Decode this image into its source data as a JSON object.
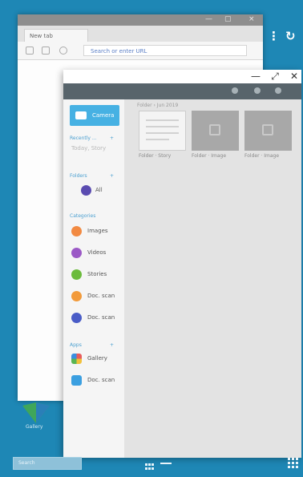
{
  "browser": {
    "tab_label": "New tab",
    "url": "Search or enter URL",
    "controls": {
      "minimize": "—",
      "maximize": "▢",
      "close": "×"
    }
  },
  "top_controls": {
    "more": "⋮",
    "refresh": "↻"
  },
  "gallery": {
    "window_controls": {
      "minimize": "—",
      "maximize": "⤢",
      "close": "✕"
    },
    "camera_label": "Camera",
    "sections": [
      {
        "label": "Recently ...",
        "expand": "+"
      },
      {
        "label": "Folders",
        "expand": "+"
      },
      {
        "label": "Categories",
        "expand": ""
      },
      {
        "label": "Apps",
        "expand": "+"
      }
    ],
    "recent_item": "Today, Story",
    "folder_item": "All",
    "categories": [
      {
        "label": "Images",
        "color": "#f28a42"
      },
      {
        "label": "Videos",
        "color": "#9b59c6"
      },
      {
        "label": "Stories",
        "color": "#6bbb3c"
      },
      {
        "label": "Doc. scan",
        "color": "#f29a3a"
      },
      {
        "label": "Doc. scan",
        "color": "#4a5cc7"
      }
    ],
    "apps": [
      {
        "label": "Gallery",
        "color": "#e85c5c"
      },
      {
        "label": "Doc. scan",
        "color": "#3b9fe0"
      }
    ],
    "breadcrumb": "Folder › Jun 2019",
    "tiles": [
      {
        "label": "Folder · Story"
      },
      {
        "label": "Folder · Image"
      },
      {
        "label": "Folder · Image"
      }
    ]
  },
  "desktop": {
    "icon_label": "Gallery"
  },
  "taskbar": {
    "search_label": "Search"
  }
}
